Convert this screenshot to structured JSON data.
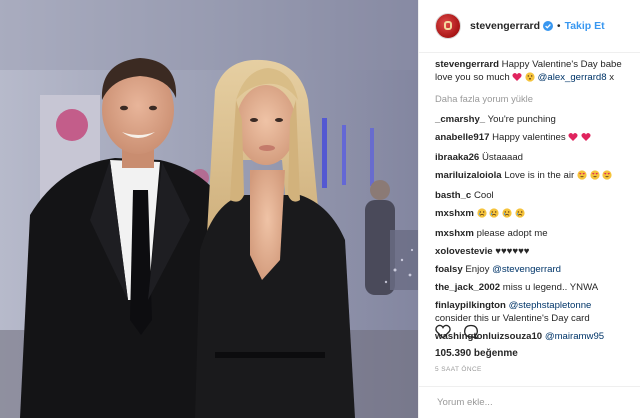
{
  "header": {
    "username": "stevengerrard",
    "dot": "•",
    "follow_label": "Takip Et",
    "verified_icon": "verified-badge-icon",
    "accent": "#3897f0"
  },
  "caption": {
    "user": "stevengerrard",
    "text": "Happy Valentine's Day babe love you so much",
    "mention": "@alex_gerrard8",
    "suffix": "x"
  },
  "load_more": "Daha fazla yorum yükle",
  "comments": [
    {
      "user": "_cmarshy_",
      "text": "You're punching"
    },
    {
      "user": "anabelle917",
      "text": "Happy valentines"
    },
    {
      "user": "ibraaka26",
      "text": "Üstaaaad"
    },
    {
      "user": "mariluizaloiola",
      "text": "Love is in the air"
    },
    {
      "user": "basth_c",
      "text": "Cool"
    },
    {
      "user": "mxshxm",
      "text": ""
    },
    {
      "user": "mxshxm",
      "text": "please adopt me"
    },
    {
      "user": "xolovestevie",
      "text": "♥♥♥♥♥♥"
    },
    {
      "user": "foalsy",
      "text": "Enjoy",
      "mention": "@stevengerrard"
    },
    {
      "user": "the_jack_2002",
      "text": "miss u legend.. YNWA"
    },
    {
      "user": "finlaypilkington",
      "mention": "@stephstapletonne",
      "text2": "consider this ur Valentine's Day card"
    },
    {
      "user": "washingtonluizsouza10",
      "mention": "@mairamw95"
    }
  ],
  "likes": "105.390 beğenme",
  "time": "5 SAAT ÖNCE",
  "add_comment_placeholder": "Yorum ekle...",
  "icons": {
    "like": "heart-outline-icon",
    "comment": "comment-bubble-icon"
  }
}
